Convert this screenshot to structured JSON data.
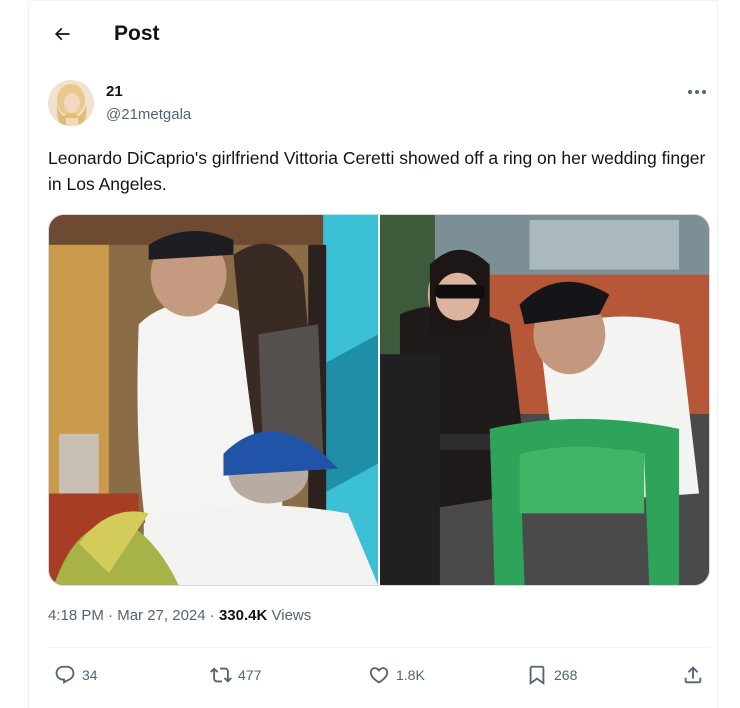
{
  "header": {
    "title": "Post"
  },
  "author": {
    "name": "21",
    "handle": "@21metgala"
  },
  "tweet": {
    "text": "Leonardo DiCaprio's girlfriend Vittoria Ceretti showed off a ring on her wedding finger in Los Angeles."
  },
  "meta": {
    "time": "4:18 PM",
    "separator1": "·",
    "date": "Mar 27, 2024",
    "separator2": "·",
    "views_count": "330.4K",
    "views_label": "Views"
  },
  "actions": {
    "replies": "34",
    "reposts": "477",
    "likes": "1.8K",
    "bookmarks": "268"
  },
  "colors": {
    "text_primary": "#0f1419",
    "text_secondary": "#536471",
    "border": "#eff3f4"
  },
  "icons": [
    "back-arrow-icon",
    "more-icon",
    "reply-icon",
    "repost-icon",
    "like-icon",
    "bookmark-icon",
    "share-icon"
  ]
}
